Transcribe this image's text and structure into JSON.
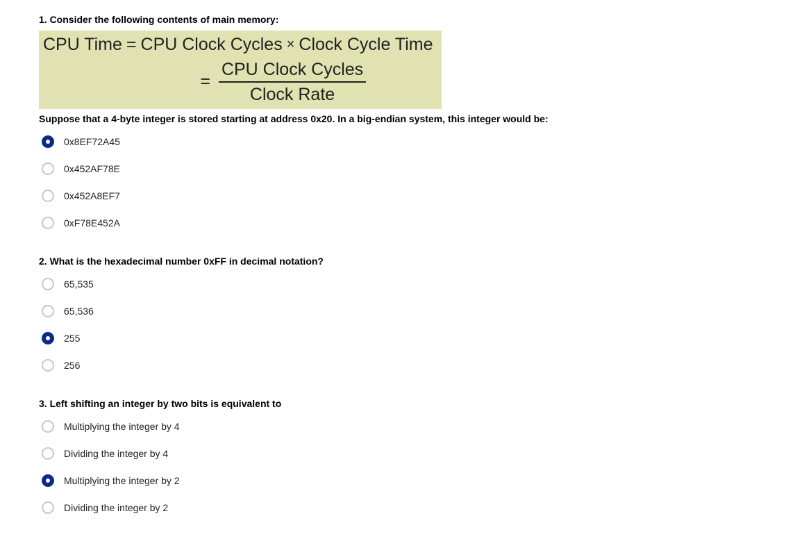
{
  "questions": [
    {
      "title": "1. Consider the following contents of main memory:",
      "formula": {
        "line1_left": "CPU Time",
        "line1_eq": "=",
        "line1_right_a": "CPU Clock Cycles",
        "line1_times": "×",
        "line1_right_b": "Clock Cycle Time",
        "line2_eq": "=",
        "line2_numerator": "CPU Clock Cycles",
        "line2_denominator": "Clock Rate"
      },
      "text": "Suppose that a 4-byte integer is stored starting at address 0x20. In a big-endian system, this integer would be:",
      "options": [
        {
          "label": "0x8EF72A45",
          "selected": true
        },
        {
          "label": "0x452AF78E",
          "selected": false
        },
        {
          "label": "0x452A8EF7",
          "selected": false
        },
        {
          "label": "0xF78E452A",
          "selected": false
        }
      ]
    },
    {
      "title": "2. What is the hexadecimal number 0xFF in decimal notation?",
      "options": [
        {
          "label": "65,535",
          "selected": false
        },
        {
          "label": "65,536",
          "selected": false
        },
        {
          "label": "255",
          "selected": true
        },
        {
          "label": "256",
          "selected": false
        }
      ]
    },
    {
      "title": "3. Left shifting an integer by two bits is equivalent to",
      "options": [
        {
          "label": "Multiplying the integer by 4",
          "selected": false
        },
        {
          "label": "Dividing the integer by 4",
          "selected": false
        },
        {
          "label": "Multiplying the integer by 2",
          "selected": true
        },
        {
          "label": "Dividing the integer by 2",
          "selected": false
        }
      ]
    }
  ]
}
